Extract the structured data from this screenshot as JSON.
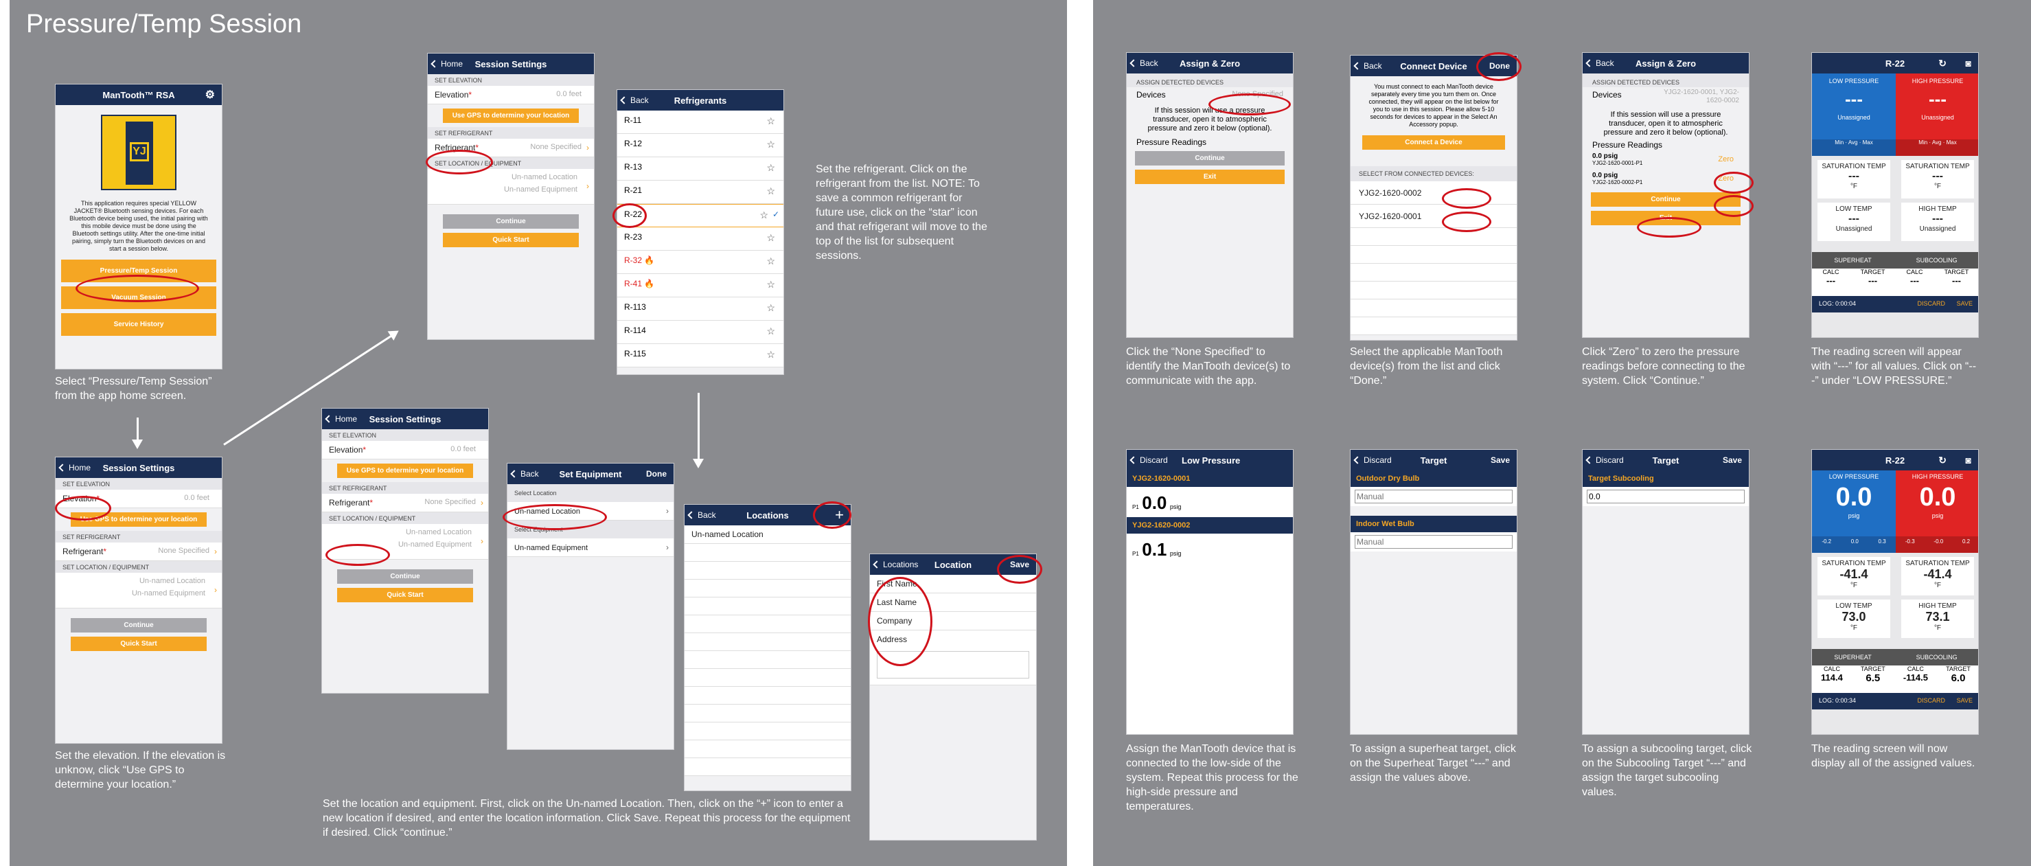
{
  "left_panel": {
    "title": "Pressure/Temp Session"
  },
  "home": {
    "title": "ManTooth™ RSA",
    "body": "This application requires special YELLOW JACKET® Bluetooth sensing devices. For each Bluetooth device being used, the initial pairing with this mobile device must be done using the Bluetooth settings utility. After the one-time initial pairing, simply turn the Bluetooth devices on and start a session below.",
    "buttons": [
      "Pressure/Temp Session",
      "Vacuum Session",
      "Service History"
    ]
  },
  "captions": {
    "home": "Select “Pressure/Temp Session” from the app home screen.",
    "elevation": "Set the elevation. If the elevation is unknow, click “Use GPS to determine your location.”",
    "refrigerant": "Set the refrigerant. Click on the refrigerant from the list. NOTE: To save a common refrigerant for future use, click on the “star” icon and that refrigerant will move to the top of the list for subsequent sessions.",
    "location": "Set the location and equipment. First, click on the Un-named Location. Then, click on the “+” icon to enter a new location if desired, and enter the location information. Click Save. Repeat this process for the equipment if desired. Click “continue.”",
    "r1": "Click the “None Specified” to identify the ManTooth device(s) to communicate with the app.",
    "r2": "Select the applicable ManTooth device(s) from the list and click “Done.”",
    "r3": "Click “Zero” to zero the pressure readings before connecting to the system. Click “Continue.”",
    "r4": "The reading screen will appear with “---” for all values. Click on “---” under “LOW PRESSURE.”",
    "r5": "Assign the ManTooth device that is connected to the low-side of the system. Repeat this process for the high-side pressure and temperatures.",
    "r6": "To assign a superheat target, click on the Superheat Target “---” and assign the values above.",
    "r7": "To assign a subcooling target, click on the Subcooling Target “---” and assign the target subcooling values.",
    "r8": "The reading screen will now display all of the assigned values."
  },
  "settings": {
    "back": "Home",
    "title": "Session Settings",
    "sec_elev": "SET ELEVATION",
    "elev_label": "Elevation",
    "elev_val": "0.0 feet",
    "gps": "Use GPS to determine your location",
    "sec_ref": "SET REFRIGERANT",
    "ref_label": "Refrigerant",
    "ref_val": "None Specified",
    "sec_loc": "SET LOCATION / EQUIPMENT",
    "loc_val": "Un-named Location",
    "eq_val": "Un-named Equipment",
    "continue": "Continue",
    "quick": "Quick Start"
  },
  "refrigerants": {
    "back": "Back",
    "title": "Refrigerants",
    "items": [
      "R-11",
      "R-12",
      "R-13",
      "R-21",
      "R-22",
      "R-23",
      "R-32",
      "R-41",
      "R-113",
      "R-114",
      "R-115"
    ]
  },
  "set_equipment": {
    "back": "Back",
    "title": "Set Equipment",
    "done": "Done",
    "sec1": "Select Location",
    "loc": "Un-named Location",
    "sec2": "Select Equipment",
    "eq": "Un-named Equipment"
  },
  "locations": {
    "back": "Back",
    "title": "Locations",
    "item": "Un-named Location"
  },
  "location_form": {
    "back": "Locations",
    "title": "Location",
    "save": "Save",
    "fields": [
      "First Name",
      "Last Name",
      "Company",
      "Address"
    ]
  },
  "assign": {
    "back": "Back",
    "title": "Assign & Zero",
    "sec": "ASSIGN DETECTED DEVICES",
    "devices": "Devices",
    "devices_val": "None Specified",
    "devices_val2": "YJG2-1620-0001, YJG2-1620-0002",
    "note": "If this session will use a pressure transducer, open it to atmospheric pressure and zero it below (optional).",
    "readings": "Pressure Readings",
    "continue": "Continue",
    "exit": "Exit",
    "p1": "0.0 psig",
    "d1": "YJG2-1620-0001-P1",
    "p2": "0.0 psig",
    "d2": "YJG2-1620-0002-P1",
    "zero": "Zero"
  },
  "connect": {
    "back": "Back",
    "title": "Connect Device",
    "done": "Done",
    "note": "You must connect to each ManTooth device separately every time you turn them on. Once connected, they will appear on the list below for you to use in this session. Please allow 5-10 seconds for devices to appear in the Select An Accessory popup.",
    "btn": "Connect a Device",
    "sec": "SELECT FROM CONNECTED DEVICES:",
    "items": [
      "YJG2-1620-0002",
      "YJG2-1620-0001"
    ]
  },
  "reading": {
    "title": "R-22",
    "low": "LOW PRESSURE",
    "high": "HIGH PRESSURE",
    "dash": "---",
    "unassigned": "Unassigned",
    "min": "Min",
    "avg": "Avg",
    "max": "Max",
    "sat": "SATURATION TEMP",
    "f": "°F",
    "low_temp": "LOW TEMP",
    "high_temp": "HIGH TEMP",
    "superheat": "SUPERHEAT",
    "subcooling": "SUBCOOLING",
    "calc": "CALC",
    "target": "TARGET",
    "log1": "LOG: 0:00:04",
    "log2": "LOG: 0:00:34",
    "discard": "DISCARD",
    "save": "SAVE",
    "psig": "psig",
    "low_val": "0.0",
    "high_val": "0.0",
    "low_stats": [
      "-0.2",
      "0.0",
      "0.3"
    ],
    "high_stats": [
      "-0.3",
      "-0.0",
      "0.2"
    ],
    "sat_low": "-41.4",
    "sat_high": "-41.4",
    "lt": "73.0",
    "ht": "73.1",
    "sh_calc": "114.4",
    "sh_target": "6.5",
    "sc_calc": "-114.5",
    "sc_target": "6.0"
  },
  "low_pressure": {
    "back": "Discard",
    "title": "Low Pressure",
    "d1": "YJG2-1620-0001",
    "v1": "0.0",
    "d2": "YJG2-1620-0002",
    "v2": "0.1",
    "unit": "psig",
    "p": "P1"
  },
  "target_sh": {
    "back": "Discard",
    "title": "Target",
    "save": "Save",
    "s1": "Outdoor Dry Bulb",
    "s2": "Indoor Wet Bulb",
    "ph": "Manual"
  },
  "target_sc": {
    "back": "Discard",
    "title": "Target",
    "save": "Save",
    "s1": "Target Subcooling",
    "val": "0.0"
  },
  "colors": {
    "panel": "#8a8b8f",
    "nav": "#1b2f55",
    "accent": "#f5a623",
    "red_oval": "#d0121b",
    "low_blue": "#1f6fc4",
    "high_red": "#e02424"
  }
}
